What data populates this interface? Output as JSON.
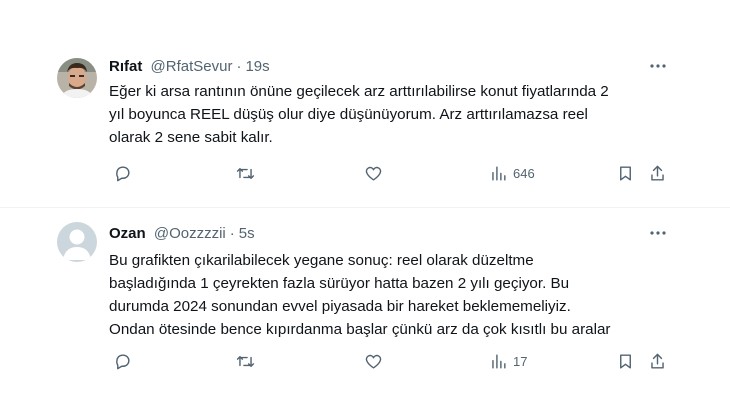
{
  "tweets": [
    {
      "name": "Rıfat",
      "handle": "@RfatSevur",
      "separator": "·",
      "time": "19s",
      "more_icon": "more-horizontal-icon",
      "lines": [
        "Eğer ki arsa rantının önüne geçilecek arz arttırılabilirse konut fiyatlarında 2",
        "yıl boyunca REEL düşüş olur diye düşünüyorum. Arz arttırılamazsa reel",
        "olarak 2 sene sabit kalır."
      ],
      "actions": {
        "reply_icon": "reply-icon",
        "retweet_icon": "retweet-icon",
        "like_icon": "heart-icon",
        "views_icon": "views-icon",
        "views_count": "646",
        "bookmark_icon": "bookmark-icon",
        "share_icon": "share-icon"
      }
    },
    {
      "name": "Ozan",
      "handle": "@Oozzzzii",
      "separator": "·",
      "time": "5s",
      "more_icon": "more-horizontal-icon",
      "lines": [
        "Bu grafikten çıkarilabilecek yegane sonuç: reel olarak düzeltme",
        "başladığında 1 çeyrekten fazla sürüyor hatta bazen 2 yılı geçiyor. Bu",
        "durumda 2024 sonundan evvel piyasada bir hareket beklememeliyiz.",
        "Ondan ötesinde bence kıpırdanma başlar çünkü arz da çok kısıtlı bu aralar"
      ],
      "actions": {
        "reply_icon": "reply-icon",
        "retweet_icon": "retweet-icon",
        "like_icon": "heart-icon",
        "views_icon": "views-icon",
        "views_count": "17",
        "bookmark_icon": "bookmark-icon",
        "share_icon": "share-icon"
      }
    }
  ]
}
